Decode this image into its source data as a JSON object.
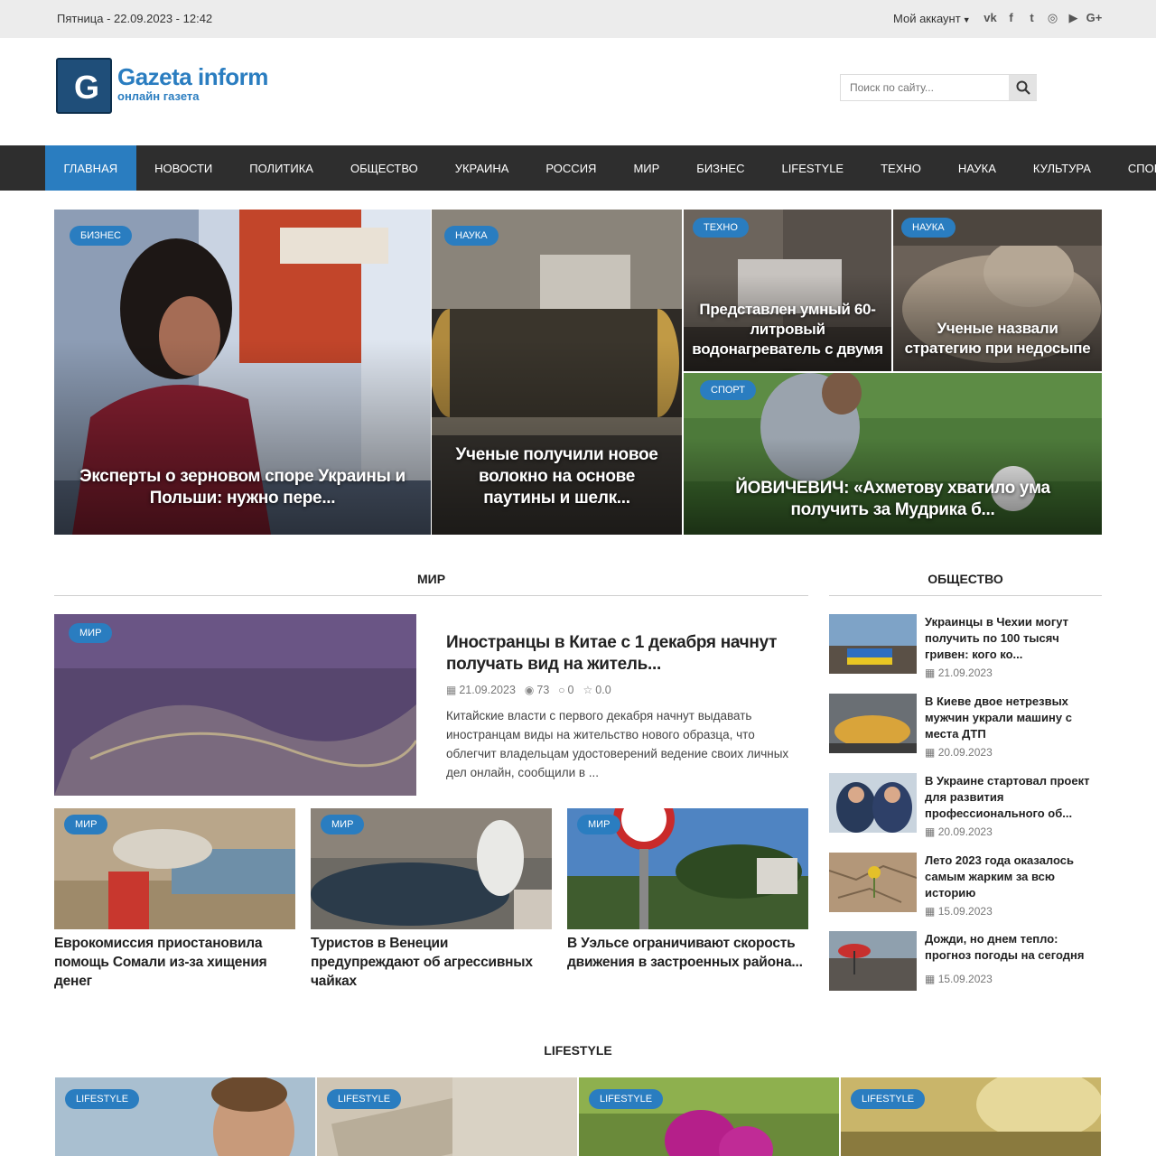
{
  "topbar": {
    "date": "Пятница - 22.09.2023 - 12:42",
    "account": "Мой аккаунт",
    "socials": [
      {
        "icon": "vk-icon",
        "glyph": "vk"
      },
      {
        "icon": "facebook-icon",
        "glyph": "f"
      },
      {
        "icon": "twitter-icon",
        "glyph": "t"
      },
      {
        "icon": "instagram-icon",
        "glyph": "◎"
      },
      {
        "icon": "youtube-icon",
        "glyph": "▶"
      },
      {
        "icon": "google-plus-icon",
        "glyph": "G+"
      }
    ]
  },
  "header": {
    "logo_letter": "G",
    "logo_name": "Gazeta inform",
    "logo_sub": "онлайн газета",
    "search_placeholder": "Поиск по сайту..."
  },
  "nav": [
    "Главная",
    "Новости",
    "Политика",
    "Общество",
    "Украина",
    "Россия",
    "Мир",
    "Бизнес",
    "Lifestyle",
    "Техно",
    "Наука",
    "Культура",
    "Спорт"
  ],
  "hero": [
    {
      "badge": "Бизнес",
      "title": "Эксперты о зерновом споре Украины и Польши: нужно пере..."
    },
    {
      "badge": "Наука",
      "title": "Ученые получили новое волокно на основе паутины и шелк..."
    },
    {
      "badge": "Техно",
      "title": "Представлен умный 60-литровый водонагреватель с двумя ..."
    },
    {
      "badge": "Наука",
      "title": "Ученые назвали стратегию при недосыпе"
    },
    {
      "badge": "Спорт",
      "title": "ЙОВИЧЕВИЧ: «Ахметову хватило ума получить за Мудрика б..."
    }
  ],
  "mir": {
    "section_title": "Мир",
    "featured": {
      "badge": "Мир",
      "title": "Иностранцы в Китае с 1 декабря начнут получать вид на житель...",
      "date": "21.09.2023",
      "views": "73",
      "comments": "0",
      "rating": "0.0",
      "excerpt": "Китайские власти с первого декабря начнут выдавать иностранцам виды на жительство нового образца, что облегчит владельцам удостоверений ведение своих личных дел онлайн, сообщили в ..."
    },
    "cards": [
      {
        "badge": "Мир",
        "title": "Еврокомиссия приостановила помощь Сомали из-за хищения денег"
      },
      {
        "badge": "Мир",
        "title": "Туристов в Венеции предупреждают об агрессивных чайках"
      },
      {
        "badge": "Мир",
        "title": "В Уэльсе ограничивают скорость движения в застроенных района..."
      }
    ]
  },
  "obshchestvo": {
    "section_title": "Общество",
    "items": [
      {
        "title": "Украинцы в Чехии могут получить по 100 тысяч гривен: кого ко...",
        "date": "21.09.2023"
      },
      {
        "title": "В Киеве двое нетрезвых мужчин украли машину с места ДТП",
        "date": "20.09.2023"
      },
      {
        "title": "В Украине стартовал проект для развития профессионального об...",
        "date": "20.09.2023"
      },
      {
        "title": "Лето 2023 года оказалось самым жарким за всю историю",
        "date": "15.09.2023"
      },
      {
        "title": "Дожди, но днем тепло: прогноз погоды на сегодня",
        "date": "15.09.2023"
      }
    ]
  },
  "lifestyle": {
    "section_title": "Lifestyle",
    "badges": [
      "Lifestyle",
      "Lifestyle",
      "Lifestyle",
      "Lifestyle"
    ]
  },
  "colors": {
    "accent": "#2a7dc0",
    "nav_bg": "#2e2e2e",
    "topbar_bg": "#ececec"
  }
}
